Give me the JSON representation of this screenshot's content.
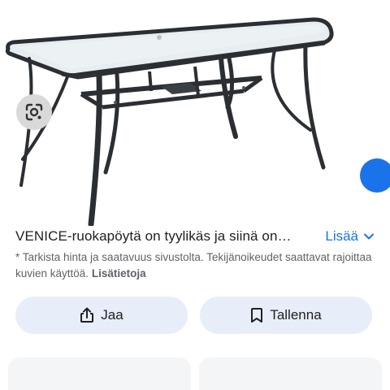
{
  "result": {
    "description": "VENICE-ruokapöytä on tyylikäs ja siinä on…",
    "more_label": "Lisää",
    "disclaimer_text": "* Tarkista hinta ja saatavuus sivustolta. Tekijänoikeudet saattavat rajoittaa kuvien käyttöä.",
    "disclaimer_link": "Lisätietoja"
  },
  "actions": {
    "share_label": "Jaa",
    "save_label": "Tallenna"
  },
  "icons": {
    "lens": "google-lens-icon",
    "more": "chevron-down-icon",
    "share": "share-icon",
    "save": "bookmark-icon"
  },
  "colors": {
    "accent": "#1a73e8",
    "button_bg": "#e8eef9",
    "lens_bg": "#d9d9d9",
    "text": "#202124",
    "muted_text": "#5f6368"
  }
}
